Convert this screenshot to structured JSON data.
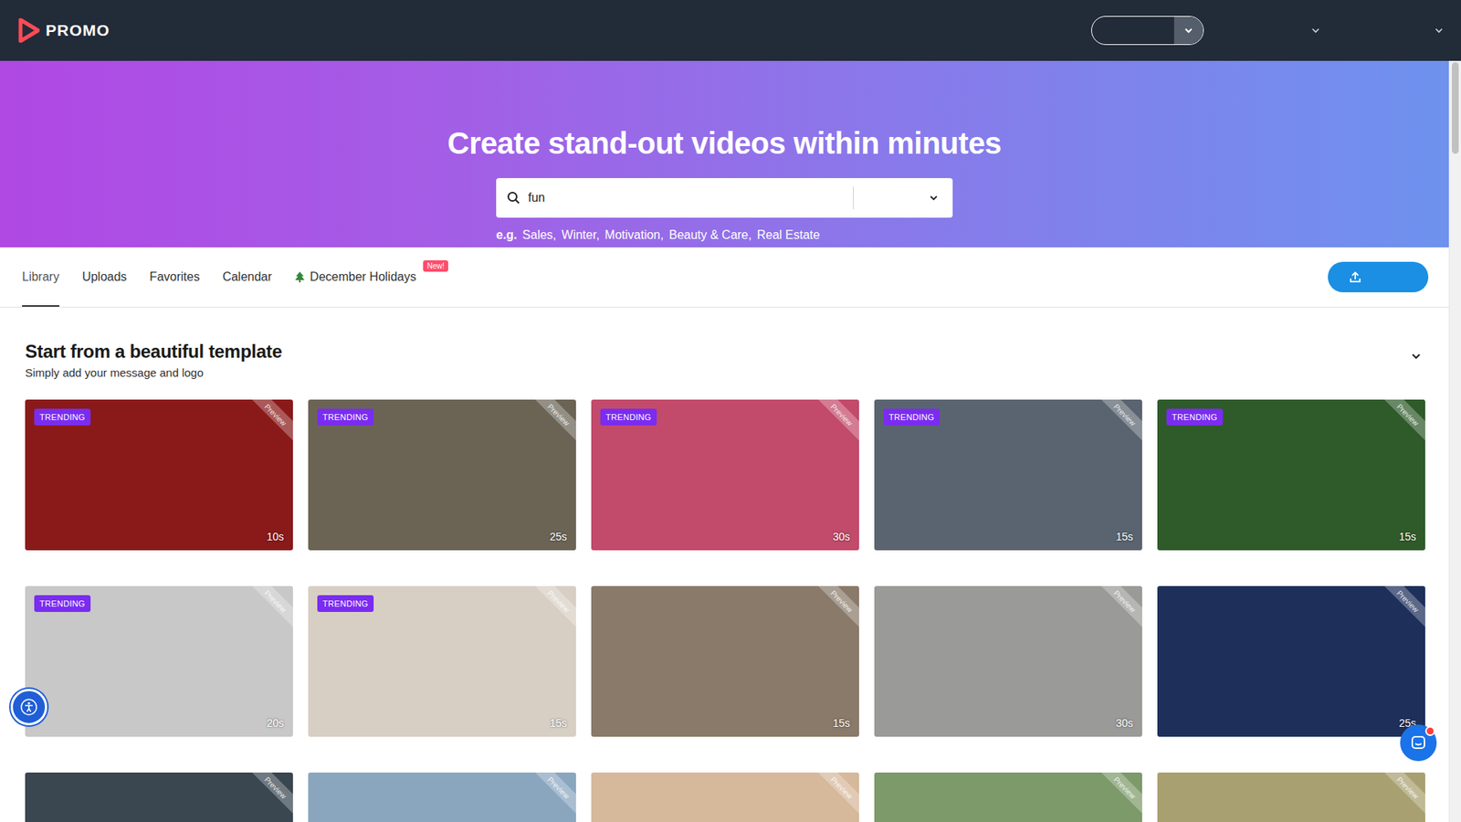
{
  "nav": {
    "logo": "PROMO"
  },
  "hero": {
    "title": "Create stand-out videos within minutes",
    "search": {
      "value": "fun"
    },
    "examples_prefix": "e.g.",
    "examples": [
      "Sales,",
      "Winter,",
      "Motivation,",
      "Beauty & Care,",
      "Real Estate"
    ]
  },
  "tabs": [
    {
      "label": "Library",
      "selected": true,
      "badge": ""
    },
    {
      "label": "Uploads",
      "selected": false,
      "badge": ""
    },
    {
      "label": "Favorites",
      "selected": false,
      "badge": ""
    },
    {
      "label": "Calendar",
      "selected": false,
      "badge": ""
    },
    {
      "label": "December Holidays",
      "selected": false,
      "badge": "New!"
    }
  ],
  "section": {
    "title": "Start from a beautiful template",
    "subtitle": "Simply add your message and logo"
  },
  "cards": [
    {
      "trending": true,
      "badge": "TRENDING",
      "duration": "10s",
      "preview": "Preview",
      "color": "#8a1a1a"
    },
    {
      "trending": true,
      "badge": "TRENDING",
      "duration": "25s",
      "preview": "Preview",
      "color": "#6b6455"
    },
    {
      "trending": true,
      "badge": "TRENDING",
      "duration": "30s",
      "preview": "Preview",
      "color": "#c24a6a"
    },
    {
      "trending": true,
      "badge": "TRENDING",
      "duration": "15s",
      "preview": "Preview",
      "color": "#5a6470"
    },
    {
      "trending": true,
      "badge": "TRENDING",
      "duration": "15s",
      "preview": "Preview",
      "color": "#2f5a2a"
    },
    {
      "trending": true,
      "badge": "TRENDING",
      "duration": "20s",
      "preview": "Preview",
      "color": "#c8c8c8"
    },
    {
      "trending": true,
      "badge": "TRENDING",
      "duration": "15s",
      "preview": "Preview",
      "color": "#d8cfc4"
    },
    {
      "trending": false,
      "badge": "",
      "duration": "15s",
      "preview": "Preview",
      "color": "#8a7a6a"
    },
    {
      "trending": false,
      "badge": "",
      "duration": "30s",
      "preview": "Preview",
      "color": "#9a9a98"
    },
    {
      "trending": false,
      "badge": "",
      "duration": "25s",
      "preview": "Preview",
      "color": "#1e2f5a"
    },
    {
      "trending": false,
      "badge": "",
      "duration": "",
      "preview": "Preview",
      "color": "#3a4650"
    },
    {
      "trending": false,
      "badge": "",
      "duration": "",
      "preview": "Preview",
      "color": "#8aa6bf"
    },
    {
      "trending": false,
      "badge": "",
      "duration": "",
      "preview": "Preview",
      "color": "#d6b89a"
    },
    {
      "trending": false,
      "badge": "",
      "duration": "",
      "preview": "Preview",
      "color": "#7d9a6a"
    },
    {
      "trending": false,
      "badge": "",
      "duration": "",
      "preview": "Preview",
      "color": "#a8a070"
    }
  ]
}
